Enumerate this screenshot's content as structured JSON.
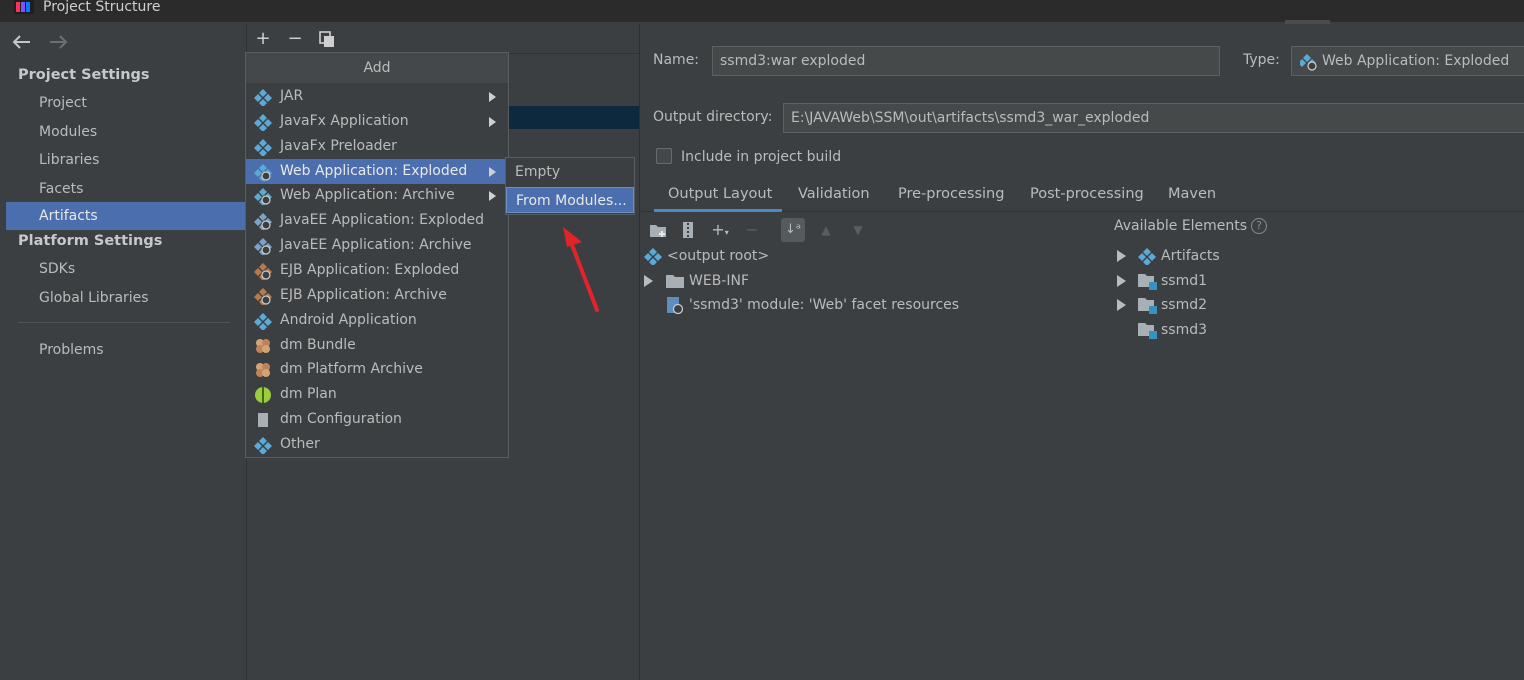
{
  "window": {
    "title": "Project Structure"
  },
  "sidebar": {
    "project_settings_header": "Project Settings",
    "project_items": [
      {
        "label": "Project"
      },
      {
        "label": "Modules"
      },
      {
        "label": "Libraries"
      },
      {
        "label": "Facets"
      },
      {
        "label": "Artifacts",
        "selected": true
      }
    ],
    "platform_settings_header": "Platform Settings",
    "platform_items": [
      {
        "label": "SDKs"
      },
      {
        "label": "Global Libraries"
      }
    ],
    "problems": "Problems"
  },
  "artifact_list_toolbar": {
    "add": "+",
    "remove": "−",
    "copy": "copy"
  },
  "add_menu": {
    "header": "Add",
    "items": [
      {
        "label": "JAR",
        "submenu": true
      },
      {
        "label": "JavaFx Application",
        "submenu": true
      },
      {
        "label": "JavaFx Preloader",
        "submenu": false
      },
      {
        "label": "Web Application: Exploded",
        "submenu": true,
        "highlighted": true
      },
      {
        "label": "Web Application: Archive",
        "submenu": true
      },
      {
        "label": "JavaEE Application: Exploded"
      },
      {
        "label": "JavaEE Application: Archive"
      },
      {
        "label": "EJB Application: Exploded"
      },
      {
        "label": "EJB Application: Archive"
      },
      {
        "label": "Android Application"
      },
      {
        "label": "dm Bundle"
      },
      {
        "label": "dm Platform Archive"
      },
      {
        "label": "dm Plan"
      },
      {
        "label": "dm Configuration"
      },
      {
        "label": "Other"
      }
    ]
  },
  "submenu": {
    "items": [
      {
        "label": "Empty"
      },
      {
        "label": "From Modules...",
        "highlighted": true
      }
    ]
  },
  "artifact": {
    "name_label": "Name:",
    "name_value": "ssmd3:war exploded",
    "type_label": "Type:",
    "type_value": "Web Application: Exploded",
    "output_dir_label": "Output directory:",
    "output_dir_value": "E:\\JAVAWeb\\SSM\\out\\artifacts\\ssmd3_war_exploded",
    "include_label": "Include in project build",
    "include_checked": false
  },
  "tabs": [
    {
      "label": "Output Layout",
      "active": true
    },
    {
      "label": "Validation"
    },
    {
      "label": "Pre-processing"
    },
    {
      "label": "Post-processing"
    },
    {
      "label": "Maven"
    }
  ],
  "output_tree": [
    {
      "label": "<output root>"
    },
    {
      "label": "WEB-INF"
    },
    {
      "label": "'ssmd3' module: 'Web' facet resources"
    }
  ],
  "available": {
    "header": "Available Elements",
    "help": "?",
    "items": [
      {
        "label": "Artifacts"
      },
      {
        "label": "ssmd1"
      },
      {
        "label": "ssmd2"
      },
      {
        "label": "ssmd3"
      }
    ]
  },
  "colors": {
    "accent": "#4b6eaf",
    "panel_bg": "#3c3f41",
    "annotation_arrow": "#e0242a"
  }
}
